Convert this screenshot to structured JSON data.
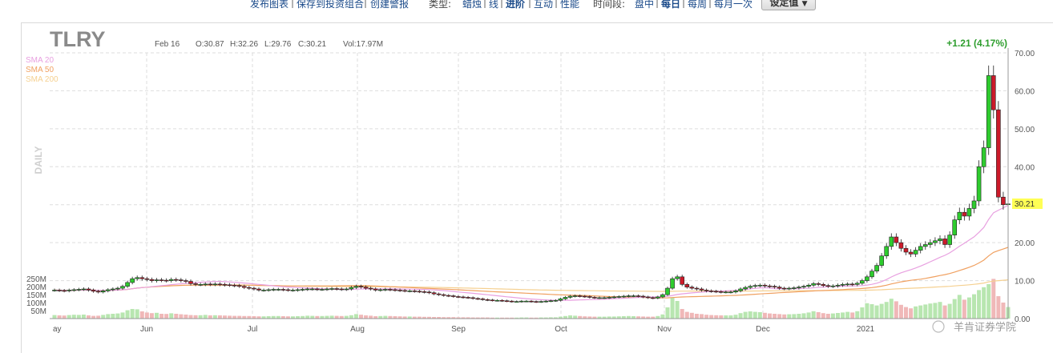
{
  "toolbar": {
    "links": [
      "发布图表",
      "保存到投资组合",
      "创建警报"
    ],
    "type_label": "类型:",
    "types": [
      "蜡烛",
      "线",
      "进阶",
      "互动",
      "性能"
    ],
    "period_label": "时间段:",
    "periods": [
      "盘中",
      "每日",
      "每周",
      "每月一次"
    ],
    "settings_button": "设定值"
  },
  "header": {
    "ticker": "TLRY",
    "date": "Feb 16",
    "open": "O:30.87",
    "high": "H:32.26",
    "low": "L:29.76",
    "close": "C:30.21",
    "volume": "Vol:17.97M",
    "change": "+1.21 (4.17%)"
  },
  "legend": [
    {
      "label": "SMA 20",
      "color": "#e8a0e0"
    },
    {
      "label": "SMA 50",
      "color": "#f0a060"
    },
    {
      "label": "SMA 200",
      "color": "#f5d090"
    }
  ],
  "side_label": "DAILY",
  "last_price_tag": "30.21",
  "watermark": "羊肯证券学院",
  "colors": {
    "up": "#2ecc2e",
    "down": "#cc1a2a",
    "volume_up": "#b8e6b0",
    "volume_down": "#f0b8b8",
    "grid": "#dddddd"
  },
  "chart_data": {
    "type": "candlestick",
    "title": "TLRY",
    "xlabel": "",
    "ylabel": "",
    "ylim": [
      0,
      70
    ],
    "y_ticks": [
      "0.00",
      "10.00",
      "20.00",
      "30.00",
      "40.00",
      "50.00",
      "60.00",
      "70.00"
    ],
    "volume_ticks": [
      "250M",
      "200M",
      "150M",
      "100M",
      "50M"
    ],
    "x_ticks": [
      "May",
      "Jun",
      "Jul",
      "Aug",
      "Sep",
      "Oct",
      "Nov",
      "Dec",
      "2021"
    ],
    "price": [
      7.5,
      7.4,
      7.3,
      7.5,
      7.6,
      7.7,
      7.8,
      7.5,
      7.2,
      7.0,
      7.3,
      7.6,
      7.8,
      8.0,
      8.5,
      9.5,
      10.5,
      10.8,
      10.5,
      10.3,
      10.0,
      10.2,
      10.1,
      10.0,
      10.3,
      10.2,
      10.0,
      9.8,
      9.2,
      9.0,
      9.0,
      9.1,
      9.0,
      9.1,
      9.0,
      8.9,
      8.8,
      8.7,
      8.5,
      8.2,
      8.0,
      7.8,
      7.5,
      7.5,
      7.6,
      7.7,
      7.7,
      7.6,
      7.5,
      7.5,
      7.6,
      7.7,
      7.8,
      7.8,
      7.7,
      7.7,
      7.8,
      7.9,
      7.8,
      7.7,
      7.8,
      8.2,
      8.5,
      8.3,
      8.0,
      7.8,
      7.5,
      7.6,
      7.7,
      7.6,
      7.5,
      7.4,
      7.3,
      7.3,
      7.2,
      7.1,
      7.0,
      6.8,
      6.5,
      6.3,
      6.1,
      6.0,
      5.8,
      5.7,
      5.6,
      5.5,
      5.3,
      5.2,
      5.0,
      4.9,
      4.8,
      4.8,
      4.7,
      4.6,
      4.5,
      4.5,
      4.6,
      4.6,
      4.5,
      4.4,
      4.5,
      4.6,
      4.7,
      4.8,
      5.2,
      5.6,
      5.9,
      6.0,
      5.9,
      5.8,
      5.6,
      5.5,
      5.5,
      5.5,
      5.6,
      5.7,
      5.8,
      5.9,
      6.0,
      6.0,
      5.9,
      5.7,
      5.5,
      5.4,
      5.7,
      6.3,
      8.0,
      10.5,
      11.0,
      9.0,
      8.3,
      8.0,
      7.8,
      7.5,
      7.3,
      7.2,
      7.1,
      7.0,
      7.0,
      7.0,
      7.3,
      7.8,
      8.2,
      8.5,
      8.7,
      8.8,
      8.6,
      8.5,
      8.3,
      8.0,
      7.9,
      8.0,
      8.1,
      8.3,
      8.5,
      8.8,
      9.2,
      9.0,
      8.7,
      8.5,
      8.6,
      8.8,
      9.0,
      9.1,
      9.0,
      9.3,
      10.0,
      11.0,
      12.5,
      14.0,
      16.5,
      19.0,
      21.5,
      20.0,
      18.5,
      17.5,
      17.0,
      18.0,
      19.0,
      19.5,
      20.0,
      20.5,
      21.0,
      19.5,
      22.0,
      26.0,
      28.0,
      27.0,
      29.0,
      31.0,
      40.0,
      45.0,
      64.0,
      55.0,
      32.0,
      30.0,
      30.21
    ],
    "volume_millions": [
      22,
      20,
      19,
      22,
      24,
      23,
      25,
      20,
      17,
      18,
      23,
      28,
      30,
      32,
      38,
      52,
      60,
      58,
      45,
      38,
      34,
      36,
      30,
      29,
      33,
      30,
      27,
      25,
      22,
      21,
      21,
      23,
      20,
      21,
      20,
      19,
      18,
      17,
      17,
      16,
      16,
      15,
      14,
      14,
      15,
      16,
      16,
      15,
      14,
      14,
      15,
      16,
      18,
      17,
      16,
      16,
      17,
      18,
      17,
      16,
      17,
      21,
      28,
      24,
      20,
      18,
      15,
      16,
      17,
      16,
      15,
      14,
      13,
      13,
      12,
      12,
      11,
      11,
      10,
      10,
      9,
      9,
      9,
      8,
      8,
      8,
      7,
      7,
      7,
      7,
      6,
      6,
      6,
      6,
      6,
      6,
      7,
      7,
      6,
      6,
      7,
      7,
      8,
      8,
      12,
      16,
      20,
      18,
      16,
      14,
      13,
      12,
      12,
      12,
      13,
      13,
      14,
      15,
      16,
      15,
      14,
      13,
      12,
      12,
      16,
      26,
      70,
      130,
      110,
      60,
      42,
      36,
      30,
      28,
      24,
      22,
      21,
      20,
      20,
      20,
      24,
      34,
      42,
      45,
      42,
      40,
      36,
      32,
      30,
      28,
      26,
      27,
      28,
      30,
      33,
      38,
      46,
      40,
      34,
      30,
      32,
      35,
      38,
      42,
      38,
      46,
      70,
      96,
      90,
      82,
      92,
      104,
      124,
      108,
      86,
      72,
      64,
      76,
      82,
      88,
      94,
      98,
      104,
      82,
      92,
      122,
      148,
      118,
      132,
      152,
      178,
      196,
      215,
      248,
      140,
      100,
      72
    ]
  }
}
